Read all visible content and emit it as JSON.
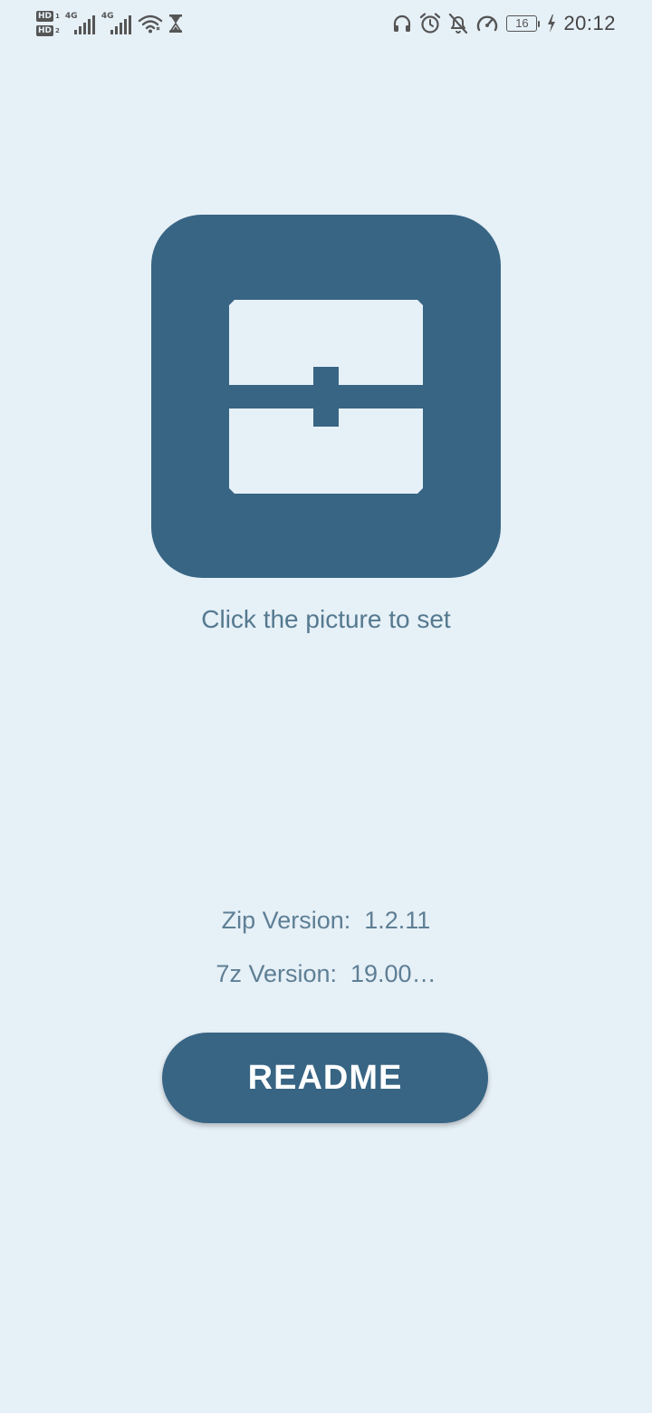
{
  "status_bar": {
    "left": {
      "hd_badges": [
        "HD",
        "HD"
      ],
      "sim_slots": [
        "1",
        "2"
      ],
      "network_labels": [
        "4G",
        "4G"
      ],
      "icons": [
        "hd-sim-icon",
        "cell-signal-icon",
        "cell-signal-icon",
        "wifi-icon",
        "hourglass-icon"
      ]
    },
    "right": {
      "icons": [
        "headphones-icon",
        "alarm-icon",
        "bell-off-icon",
        "speedometer-icon",
        "battery-icon",
        "charging-bolt-icon"
      ],
      "battery_level": "16",
      "time": "20:12"
    }
  },
  "main": {
    "app_icon": {
      "icon": "archive-chest-icon",
      "color": "#386584"
    },
    "hint": "Click the picture to set",
    "zip_version": "Zip Version:  1.2.11",
    "sevenz_version": "7z Version:  19.00…",
    "readme_button": "README"
  },
  "colors": {
    "background": "#E6F0F7",
    "accent": "#386584",
    "text_muted": "#5E7F95",
    "button_text": "#FFFFFF"
  }
}
